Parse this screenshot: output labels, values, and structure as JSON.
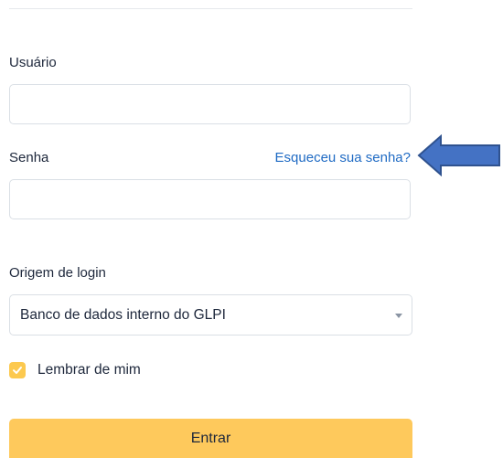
{
  "login_form": {
    "username_label": "Usuário",
    "username_value": "",
    "password_label": "Senha",
    "password_value": "",
    "forgot_password_link": "Esqueceu sua senha?",
    "login_source_label": "Origem de login",
    "login_source_selected": "Banco de dados interno do GLPI",
    "remember_me_label": "Lembrar de mim",
    "remember_me_checked": true,
    "submit_label": "Entrar"
  },
  "annotation": {
    "arrow_icon": "arrow-left-icon",
    "arrow_color": "#4472c4",
    "arrow_border_color": "#2f528f"
  },
  "colors": {
    "accent": "#fcc94f",
    "link": "#206bc4",
    "text": "#1d273b",
    "border": "#dadfe5"
  }
}
